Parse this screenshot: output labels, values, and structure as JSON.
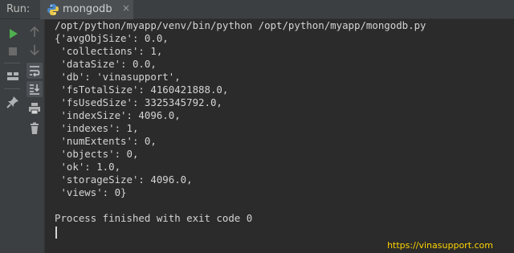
{
  "header": {
    "run_label": "Run:",
    "tab_title": "mongodb",
    "tab_close": "×"
  },
  "console": {
    "command": "/opt/python/myapp/venv/bin/python /opt/python/myapp/mongodb.py",
    "lines": [
      "{'avgObjSize': 0.0,",
      " 'collections': 1,",
      " 'dataSize': 0.0,",
      " 'db': 'vinasupport',",
      " 'fsTotalSize': 4160421888.0,",
      " 'fsUsedSize': 3325345792.0,",
      " 'indexSize': 4096.0,",
      " 'indexes': 1,",
      " 'numExtents': 0,",
      " 'objects': 0,",
      " 'ok': 1.0,",
      " 'storageSize': 4096.0,",
      " 'views': 0}"
    ],
    "exit_message": "Process finished with exit code 0"
  },
  "watermark": "https://vinasupport.com",
  "icons": {
    "run": "play-icon",
    "stop": "stop-icon",
    "layout": "layout-icon",
    "pin": "pin-icon",
    "up": "arrow-up-icon",
    "down": "arrow-down-icon",
    "wrap": "soft-wrap-icon",
    "scroll": "scroll-to-end-icon",
    "print": "print-icon",
    "trash": "trash-icon"
  },
  "colors": {
    "accent_green": "#4fb04f",
    "watermark": "#ffd400",
    "background": "#2b2b2b"
  }
}
